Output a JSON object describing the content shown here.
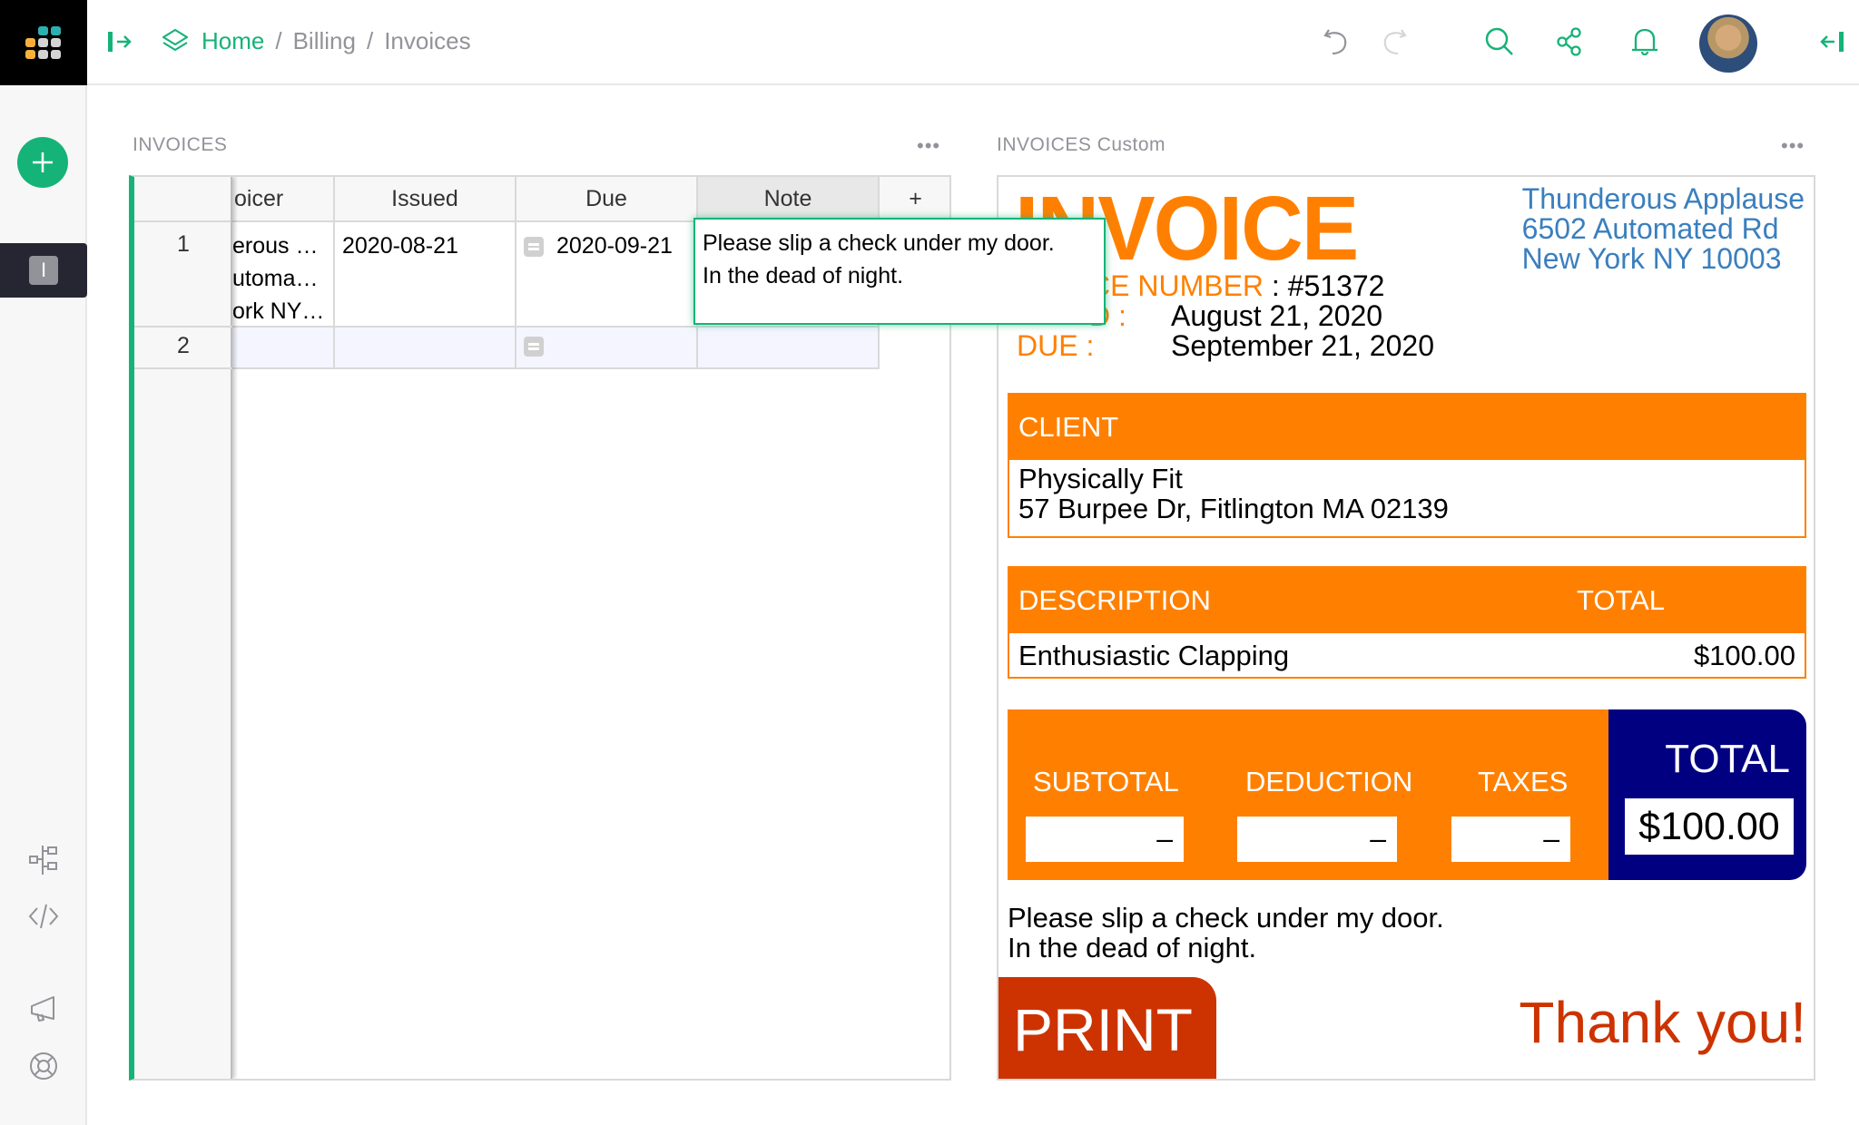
{
  "header": {
    "breadcrumb": {
      "home": "Home",
      "sep": "/",
      "section": "Billing",
      "page": "Invoices"
    },
    "icons": [
      "undo-icon",
      "redo-icon",
      "search-icon",
      "share-icon",
      "bell-icon",
      "avatar",
      "collapse-right-panel-icon"
    ]
  },
  "sidebar": {
    "add_label": "+",
    "page_initial": "I",
    "bottom_icons": [
      "raw-data-icon",
      "code-view-icon",
      "announcements-icon",
      "help-icon"
    ]
  },
  "left_panel": {
    "title": "INVOICES",
    "menu": "•••",
    "columns": [
      "oicer",
      "Issued",
      "Due",
      "Note",
      "+"
    ],
    "rows": [
      {
        "num": "1",
        "invoicer": [
          "erous …",
          "utoma…",
          "ork NY…"
        ],
        "issued": "2020-08-21",
        "due": "2020-09-21",
        "note": "Please slip a check under my door.\nIn the dead of night."
      },
      {
        "num": "2",
        "invoicer": [],
        "issued": "",
        "due": "",
        "note": ""
      }
    ],
    "editor_value": "Please slip a check under my door.\nIn the dead of night."
  },
  "right_panel": {
    "title": "INVOICES Custom",
    "menu": "•••",
    "invoice": {
      "heading": "INVOICE",
      "number_label": "CE NUMBER",
      "number_value": " : #51372",
      "issued_label": "D :",
      "issued_value": "August 21, 2020",
      "due_label": "DUE :",
      "due_value": "September 21, 2020",
      "biller": [
        "Thunderous Applause",
        "6502 Automated Rd",
        "New York NY 10003"
      ],
      "client_header": "CLIENT",
      "client": [
        "Physically Fit",
        "57 Burpee Dr, Fitlington MA 02139"
      ],
      "desc_header": "DESCRIPTION",
      "total_header": "TOTAL",
      "items": [
        {
          "description": "Enthusiastic Clapping",
          "total": "$100.00"
        }
      ],
      "subtotal_label": "SUBTOTAL",
      "subtotal_value": "–",
      "deduction_label": "DEDUCTION",
      "deduction_value": "–",
      "taxes_label": "TAXES",
      "taxes_value": "–",
      "grand_total_label": "TOTAL",
      "grand_total_value": "$100.00",
      "note": "Please slip a check under my door.\nIn the dead of night.",
      "print_label": "PRINT",
      "thanks": "Thank you!"
    }
  },
  "colors": {
    "accent": "#16b378",
    "invoice_orange": "#ff8000",
    "invoice_navy": "#000080",
    "print_red": "#cc3300",
    "biller_blue": "#3a7fbe"
  }
}
